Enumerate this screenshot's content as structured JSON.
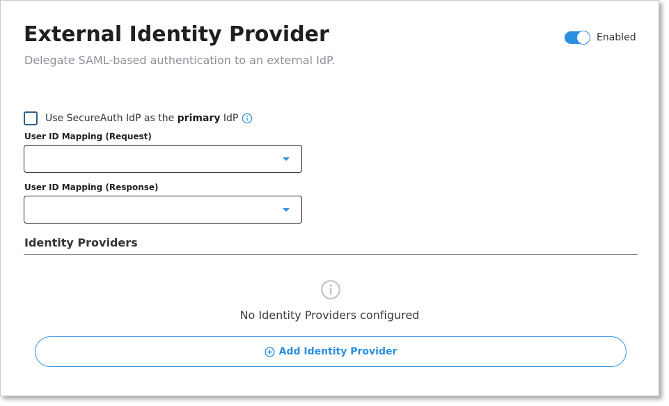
{
  "header": {
    "title": "External Identity Provider",
    "subtitle": "Delegate SAML-based authentication to an external IdP.",
    "toggle_label": "Enabled",
    "toggle_on": true
  },
  "primary_idp": {
    "label_prefix": "Use SecureAuth IdP as the ",
    "label_bold": "primary",
    "label_suffix": " IdP",
    "checked": false,
    "info_icon": "info-circle-icon"
  },
  "fields": {
    "request_mapping": {
      "label": "User ID Mapping (Request)",
      "value": ""
    },
    "response_mapping": {
      "label": "User ID Mapping (Response)",
      "value": ""
    }
  },
  "identity_providers": {
    "heading": "Identity Providers",
    "empty_icon": "info-circle-icon",
    "empty_message": "No Identity Providers configured",
    "add_button_label": "Add Identity Provider",
    "add_icon": "plus-circle-icon"
  },
  "colors": {
    "accent": "#2b8fe0",
    "checkbox_border": "#2f5f86",
    "muted_text": "#8b8f96"
  }
}
